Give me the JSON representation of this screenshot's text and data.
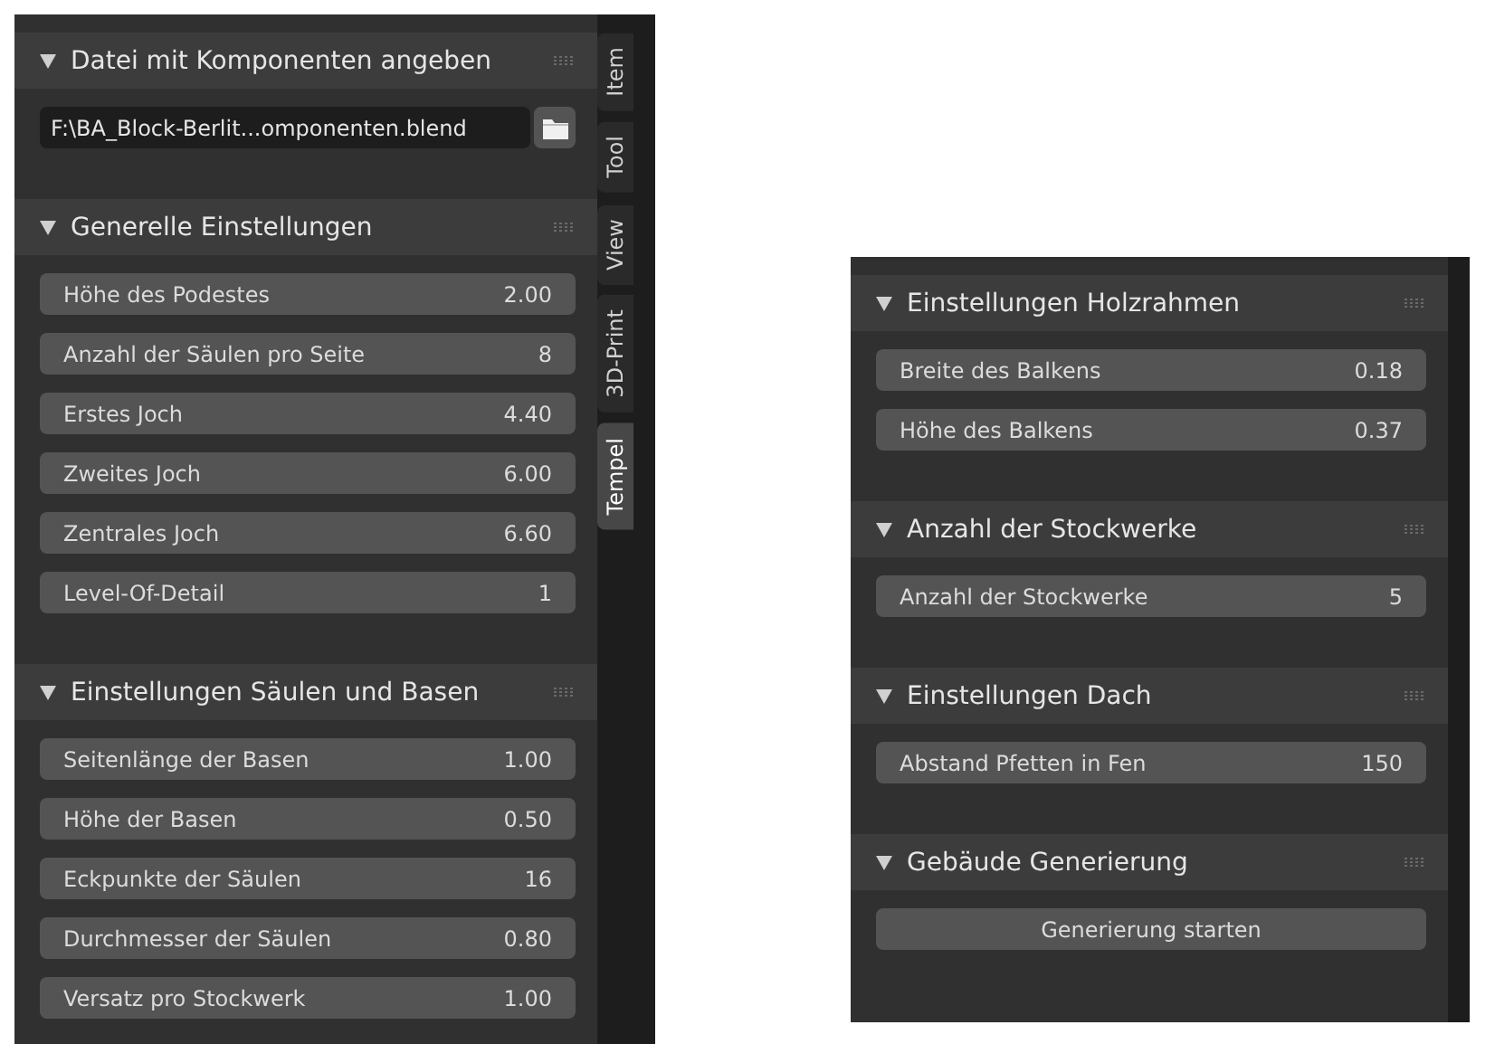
{
  "panels": [
    {
      "tabs": [
        {
          "label": "Item",
          "selected": false
        },
        {
          "label": "Tool",
          "selected": false
        },
        {
          "label": "View",
          "selected": false
        },
        {
          "label": "3D-Print",
          "selected": false
        },
        {
          "label": "Tempel",
          "selected": true
        }
      ],
      "sections": [
        {
          "title": "Datei mit Komponenten angeben",
          "expanded": true,
          "items": [
            {
              "kind": "file",
              "value": "F:\\BA_Block-Berlit...omponenten.blend"
            }
          ]
        },
        {
          "title": "Generelle Einstellungen",
          "expanded": true,
          "items": [
            {
              "kind": "number",
              "label": "Höhe des Podestes",
              "value": "2.00"
            },
            {
              "kind": "number",
              "label": "Anzahl der Säulen pro Seite",
              "value": "8"
            },
            {
              "kind": "number",
              "label": "Erstes Joch",
              "value": "4.40"
            },
            {
              "kind": "number",
              "label": "Zweites Joch",
              "value": "6.00"
            },
            {
              "kind": "number",
              "label": "Zentrales Joch",
              "value": "6.60"
            },
            {
              "kind": "number",
              "label": "Level-Of-Detail",
              "value": "1"
            }
          ]
        },
        {
          "title": "Einstellungen Säulen und Basen",
          "expanded": true,
          "items": [
            {
              "kind": "number",
              "label": "Seitenlänge der Basen",
              "value": "1.00"
            },
            {
              "kind": "number",
              "label": "Höhe der Basen",
              "value": "0.50"
            },
            {
              "kind": "number",
              "label": "Eckpunkte der Säulen",
              "value": "16"
            },
            {
              "kind": "number",
              "label": "Durchmesser der Säulen",
              "value": "0.80"
            },
            {
              "kind": "number",
              "label": "Versatz pro Stockwerk",
              "value": "1.00"
            }
          ]
        }
      ]
    },
    {
      "sections": [
        {
          "title": "Einstellungen Holzrahmen",
          "expanded": true,
          "items": [
            {
              "kind": "number",
              "label": "Breite des Balkens",
              "value": "0.18"
            },
            {
              "kind": "number",
              "label": "Höhe des Balkens",
              "value": "0.37"
            }
          ]
        },
        {
          "title": "Anzahl der Stockwerke",
          "expanded": true,
          "items": [
            {
              "kind": "number",
              "label": "Anzahl der Stockwerke",
              "value": "5"
            }
          ]
        },
        {
          "title": "Einstellungen Dach",
          "expanded": true,
          "items": [
            {
              "kind": "number",
              "label": "Abstand Pfetten in Fen",
              "value": "150"
            }
          ]
        },
        {
          "title": "Gebäude Generierung",
          "expanded": true,
          "items": [
            {
              "kind": "button",
              "label": "Generierung starten"
            }
          ]
        }
      ]
    }
  ]
}
